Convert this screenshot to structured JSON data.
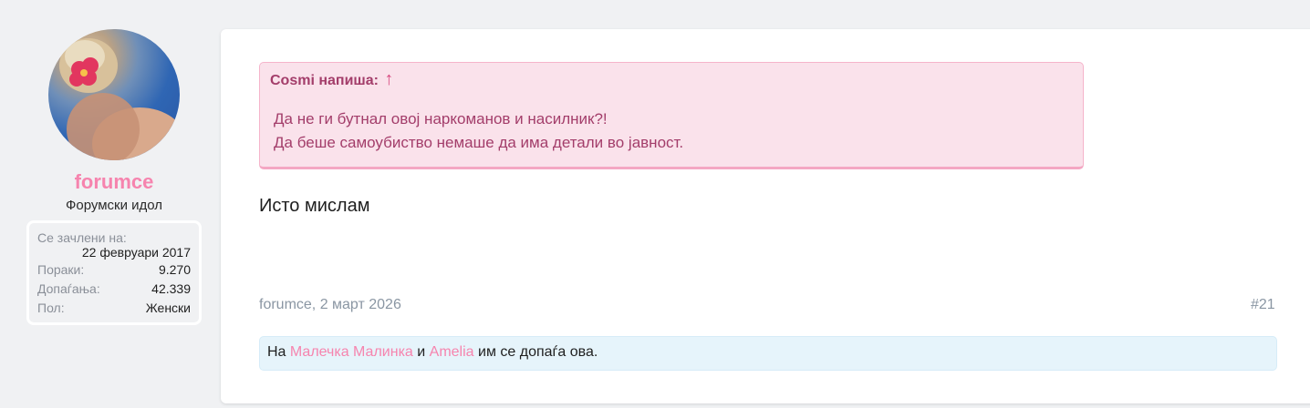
{
  "user": {
    "name": "forumce",
    "title": "Форумски идол",
    "stats": {
      "joined_label": "Се зачлени на:",
      "joined_value": "22 февруари 2017",
      "posts_label": "Пораки:",
      "posts_value": "9.270",
      "likes_label": "Допаѓања:",
      "likes_value": "42.339",
      "gender_label": "Пол:",
      "gender_value": "Женски"
    }
  },
  "post": {
    "quote": {
      "author_line": "Cosmi напиша:",
      "arrow": "↑",
      "line1": "Да не ги бутнал овој наркоманов и насилник?!",
      "line2": "Да беше самоубиство немаше да има детали во јавност."
    },
    "text": "Исто мислам",
    "meta": "forumce, 2 март 2026",
    "number": "#21",
    "likes": {
      "prefix": "На",
      "user1": "Малечка Малинка",
      "conj": "и",
      "user2": "Amelia",
      "suffix": "им се допаѓа ова."
    }
  },
  "colors": {
    "accent_pink": "#f684ae",
    "quote_bg": "#fae2eb",
    "quote_text": "#a33d6a",
    "likes_bg": "#e6f4fb"
  }
}
